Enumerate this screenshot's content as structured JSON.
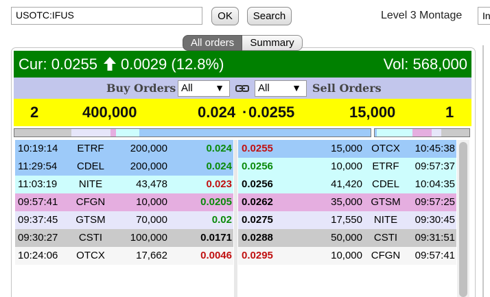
{
  "toolbar": {
    "symbol_value": "USOTC:IFUS",
    "ok_label": "OK",
    "search_label": "Search",
    "title": "Level 3 Montage",
    "right_field_value": "In"
  },
  "tabs": [
    {
      "label": "All orders",
      "active": true
    },
    {
      "label": "Summary",
      "active": false
    }
  ],
  "quote": {
    "cur_label": "Cur:",
    "cur_value": "0.0255",
    "change": "0.0029 (12.8%)",
    "direction_icon": "arrow-up-icon",
    "vol_label": "Vol:",
    "vol_value": "568,000"
  },
  "filters": {
    "buy_label": "Buy Orders",
    "sell_label": "Sell Orders",
    "buy_select": "All",
    "sell_select": "All",
    "link_icon": "link-icon"
  },
  "summary": {
    "bid_count": "2",
    "bid_size": "400,000",
    "bid_price": "0.024",
    "ask_price": "0.0255",
    "ask_size": "15,000",
    "ask_count": "1"
  },
  "colors": {
    "quote_bar": "#008000",
    "filter_bar": "#c2c6ec",
    "summary_bar": "#ffff00",
    "level_blue": "#9dcaf9",
    "level_cyan": "#cdfdfd",
    "level_pink": "#e5aee0",
    "level_lavender": "#e6e6fa",
    "level_gray": "#cacaca",
    "level_white": "#f6f6f6",
    "price_up": "#0a8a0a",
    "price_down": "#c01010"
  },
  "buy_orders": [
    {
      "time": "10:19:14",
      "mm": "ETRF",
      "size": "200,000",
      "price": "0.024",
      "price_color": "green",
      "bg": "#9dcaf9"
    },
    {
      "time": "11:29:54",
      "mm": "CDEL",
      "size": "200,000",
      "price": "0.024",
      "price_color": "green",
      "bg": "#9dcaf9"
    },
    {
      "time": "11:03:19",
      "mm": "NITE",
      "size": "43,478",
      "price": "0.023",
      "price_color": "red",
      "bg": "#cdfdfd"
    },
    {
      "time": "09:57:41",
      "mm": "CFGN",
      "size": "10,000",
      "price": "0.0205",
      "price_color": "green",
      "bg": "#e5aee0"
    },
    {
      "time": "09:37:45",
      "mm": "GTSM",
      "size": "70,000",
      "price": "0.02",
      "price_color": "green",
      "bg": "#e6e6fa"
    },
    {
      "time": "09:30:27",
      "mm": "CSTI",
      "size": "100,000",
      "price": "0.0171",
      "price_color": "black",
      "bg": "#cacaca"
    },
    {
      "time": "10:24:06",
      "mm": "OTCX",
      "size": "17,662",
      "price": "0.0046",
      "price_color": "red",
      "bg": "#f6f6f6"
    }
  ],
  "sell_orders": [
    {
      "price": "0.0255",
      "price_color": "red",
      "size": "15,000",
      "mm": "OTCX",
      "time": "10:45:38",
      "bg": "#9dcaf9"
    },
    {
      "price": "0.0256",
      "price_color": "green",
      "size": "10,000",
      "mm": "ETRF",
      "time": "09:57:37",
      "bg": "#cdfdfd"
    },
    {
      "price": "0.0256",
      "price_color": "black",
      "size": "41,420",
      "mm": "CDEL",
      "time": "10:04:35",
      "bg": "#cdfdfd"
    },
    {
      "price": "0.0262",
      "price_color": "black",
      "size": "35,000",
      "mm": "GTSM",
      "time": "09:57:25",
      "bg": "#e5aee0"
    },
    {
      "price": "0.0275",
      "price_color": "black",
      "size": "17,550",
      "mm": "NITE",
      "time": "09:30:45",
      "bg": "#e6e6fa"
    },
    {
      "price": "0.0288",
      "price_color": "black",
      "size": "50,000",
      "mm": "CSTI",
      "time": "09:31:51",
      "bg": "#cacaca"
    },
    {
      "price": "0.0295",
      "price_color": "red",
      "size": "10,000",
      "mm": "CFGN",
      "time": "09:57:41",
      "bg": "#f6f6f6"
    }
  ],
  "depth_bars": {
    "buy": [
      {
        "color": "#cacaca",
        "share": 0.16
      },
      {
        "color": "#e6e6fa",
        "share": 0.11
      },
      {
        "color": "#e5aee0",
        "share": 0.015
      },
      {
        "color": "#cdfdfd",
        "share": 0.065
      },
      {
        "color": "#9dcaf9",
        "share": 0.65
      }
    ],
    "sell": [
      {
        "color": "#9dcaf9",
        "share": 0.02
      },
      {
        "color": "#cdfdfd",
        "share": 0.38
      },
      {
        "color": "#e5aee0",
        "share": 0.2
      },
      {
        "color": "#e6e6fa",
        "share": 0.1
      },
      {
        "color": "#cacaca",
        "share": 0.3
      }
    ]
  }
}
